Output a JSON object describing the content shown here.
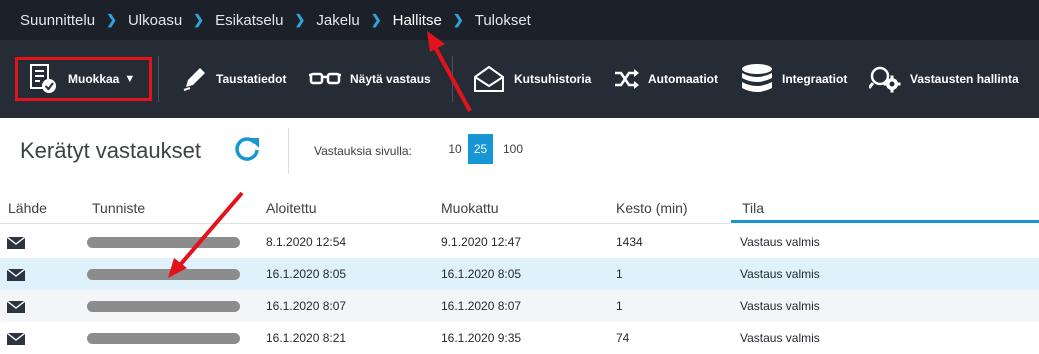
{
  "breadcrumb": {
    "items": [
      {
        "label": "Suunnittelu",
        "active": false
      },
      {
        "label": "Ulkoasu",
        "active": false
      },
      {
        "label": "Esikatselu",
        "active": false
      },
      {
        "label": "Jakelu",
        "active": false
      },
      {
        "label": "Hallitse",
        "active": true
      },
      {
        "label": "Tulokset",
        "active": false
      }
    ],
    "separator": "❯"
  },
  "toolbar": {
    "edit_label": "Muokkaa",
    "edit_caret": "▼",
    "background_label": "Taustatiedot",
    "show_response_label": "Näytä vastaus",
    "invite_history_label": "Kutsuhistoria",
    "automations_label": "Automaatiot",
    "integrations_label": "Integraatiot",
    "response_management_label": "Vastausten hallinta"
  },
  "collected": {
    "title": "Kerätyt vastaukset",
    "per_page_label": "Vastauksia sivulla:",
    "per_page_options": [
      "10",
      "25",
      "100"
    ],
    "per_page_selected": "25"
  },
  "table": {
    "columns": [
      "Lähde",
      "Tunniste",
      "Aloitettu",
      "Muokattu",
      "Kesto (min)",
      "Tila"
    ],
    "rows": [
      {
        "started": "8.1.2020 12:54",
        "modified": "9.1.2020 12:47",
        "duration": "1434",
        "status": "Vastaus valmis"
      },
      {
        "started": "16.1.2020 8:05",
        "modified": "16.1.2020 8:05",
        "duration": "1",
        "status": "Vastaus valmis"
      },
      {
        "started": "16.1.2020 8:07",
        "modified": "16.1.2020 8:07",
        "duration": "1",
        "status": "Vastaus valmis"
      },
      {
        "started": "16.1.2020 8:21",
        "modified": "16.1.2020 9:35",
        "duration": "74",
        "status": "Vastaus valmis"
      }
    ]
  },
  "colors": {
    "accent": "#1796d6",
    "annotation_red": "#e3121b",
    "toolbar_bg": "#262c36",
    "breadcrumb_bg": "#1c2129",
    "highlight_row": "#dff1fa"
  }
}
